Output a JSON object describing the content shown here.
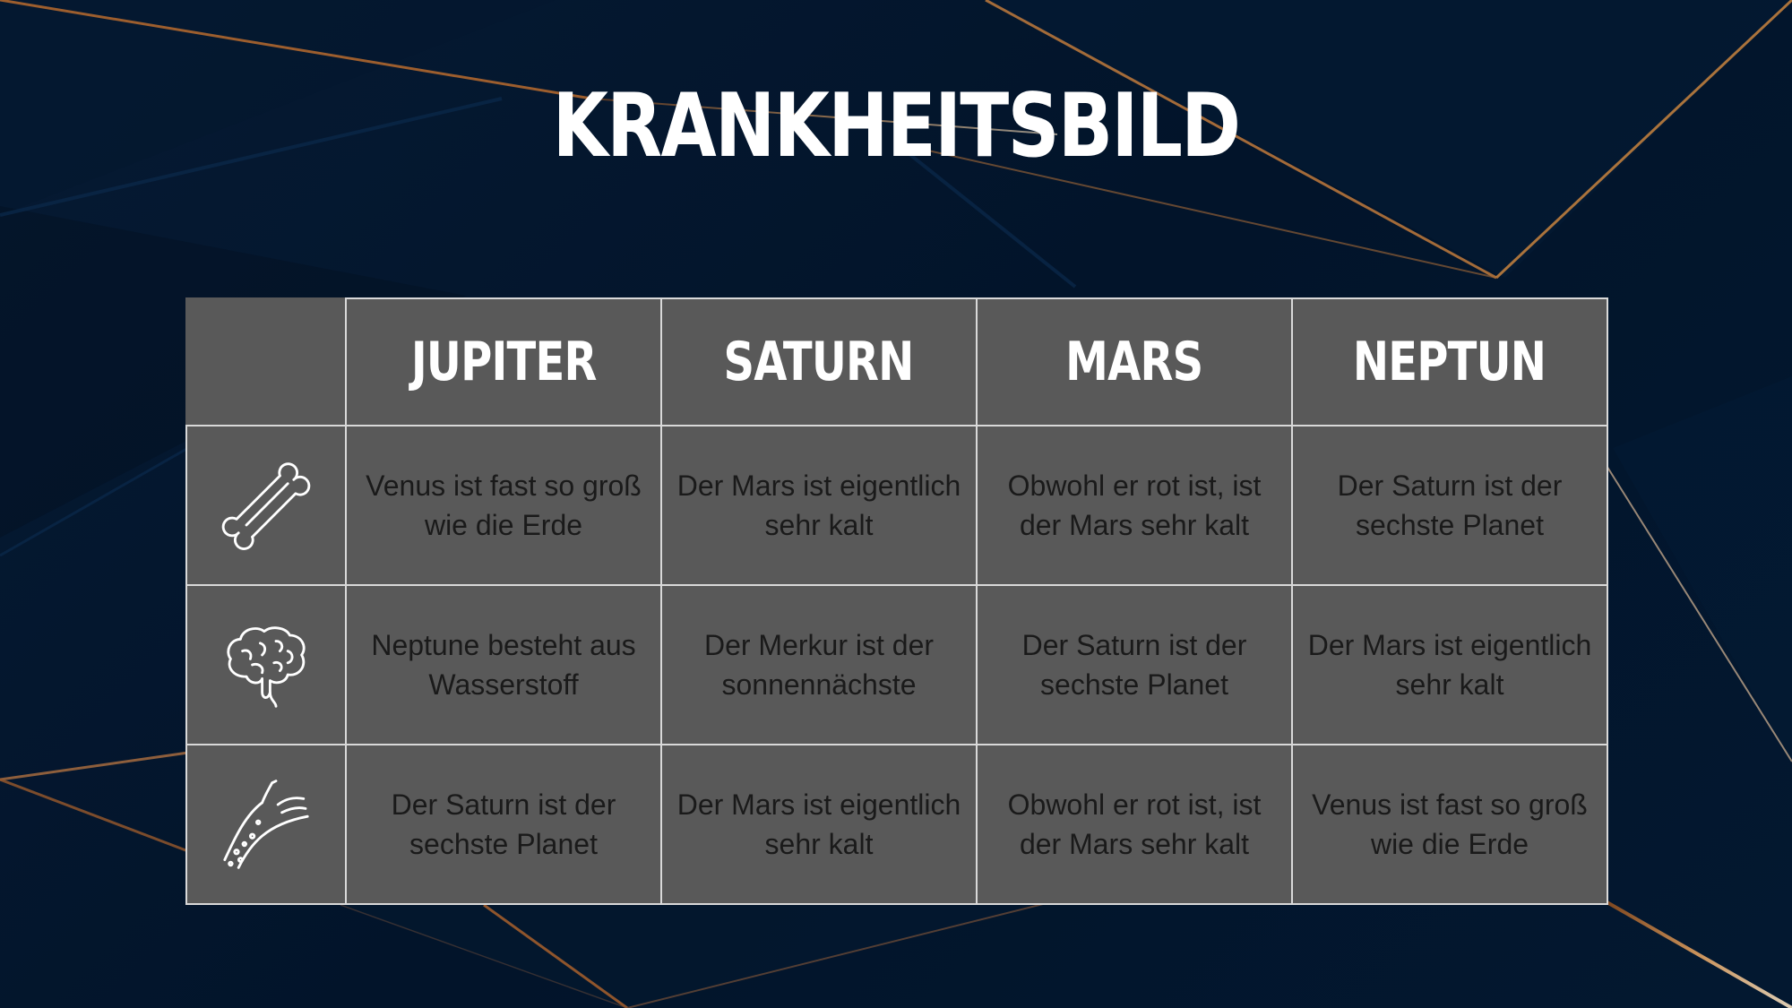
{
  "slide": {
    "title": "KRANKHEITSBILD"
  },
  "table": {
    "headers": [
      "JUPITER",
      "SATURN",
      "MARS",
      "NEPTUN"
    ],
    "rows": [
      {
        "icon": "bone-icon",
        "cells": [
          "Venus ist fast so groß wie die Erde",
          "Der Mars ist eigentlich sehr kalt",
          "Obwohl er rot ist, ist der Mars sehr kalt",
          "Der Saturn ist der sechste Planet"
        ]
      },
      {
        "icon": "brain-icon",
        "cells": [
          "Neptune besteht aus Wasserstoff",
          "Der Merkur ist der sonnennächste",
          "Der Saturn ist der sechste Planet",
          "Der Mars ist eigentlich sehr kalt"
        ]
      },
      {
        "icon": "artery-icon",
        "cells": [
          "Der Saturn ist der sechste Planet",
          "Der Mars ist eigentlich sehr kalt",
          "Obwohl er rot ist, ist der Mars sehr kalt",
          "Venus ist fast so groß wie die Erde"
        ]
      }
    ]
  },
  "colors": {
    "background": "#02142a",
    "table_fill": "#595959",
    "table_border": "#d9d9d9",
    "accent_line": "#c8783a"
  }
}
